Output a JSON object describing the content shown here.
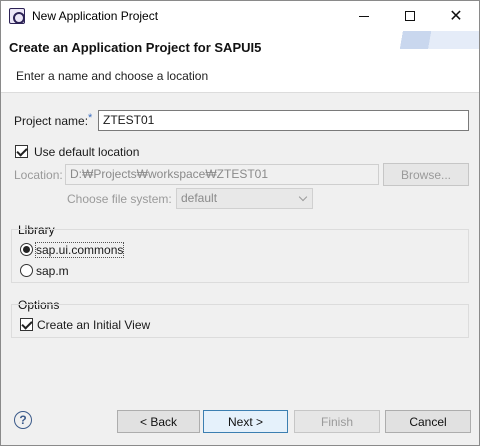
{
  "window": {
    "title": "New Application Project"
  },
  "header": {
    "title": "Create an Application Project for SAPUI5",
    "message": "Enter a name and choose a location"
  },
  "project": {
    "name_label": "Project name:",
    "required_marker": "*",
    "name_value": "ZTEST01",
    "use_default_label": "Use default location",
    "use_default_checked": true,
    "location_label": "Location:",
    "location_value": "D:₩Projects₩workspace₩ZTEST01",
    "browse_label": "Browse...",
    "file_system_label": "Choose file system:",
    "file_system_value": "default"
  },
  "library": {
    "legend": "Library",
    "options": [
      {
        "label": "sap.ui.commons",
        "selected": true
      },
      {
        "label": "sap.m",
        "selected": false
      }
    ]
  },
  "options": {
    "legend": "Options",
    "initial_view_label": "Create an Initial View",
    "initial_view_checked": true
  },
  "footer": {
    "help_glyph": "?",
    "back_label": "< Back",
    "next_label": "Next >",
    "finish_label": "Finish",
    "cancel_label": "Cancel"
  },
  "icons": {
    "app": "eclipse-icon",
    "help": "help-icon"
  }
}
